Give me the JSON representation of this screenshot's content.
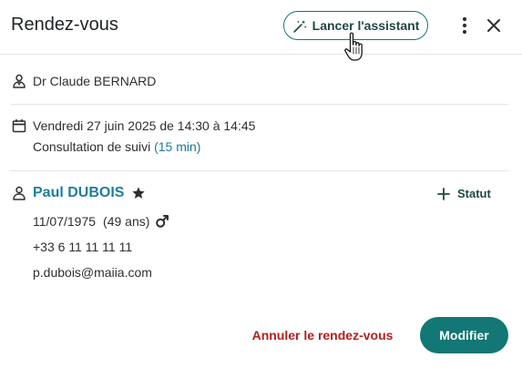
{
  "header": {
    "title": "Rendez-vous",
    "assistant_label": "Lancer l'assistant",
    "accent_color": "#127775"
  },
  "doctor": {
    "name": "Dr Claude BERNARD",
    "icon": "doctor-icon"
  },
  "appointment": {
    "datetime": "Vendredi 27 juin 2025 de 14:30 à 14:45",
    "type": "Consultation de suivi",
    "duration": "(15 min)",
    "icon": "calendar-icon"
  },
  "patient": {
    "name": "Paul DUBOIS",
    "birthdate": "11/07/1975",
    "age": "(49 ans)",
    "phone": "+33 6 11 11 11 11",
    "email": "p.dubois@maiia.com",
    "gender_icon": "male-icon",
    "favorite_icon": "star-icon",
    "statut_label": "Statut"
  },
  "footer": {
    "cancel_label": "Annuler le rendez-vous",
    "modify_label": "Modifier",
    "cancel_color": "#b1201e"
  }
}
